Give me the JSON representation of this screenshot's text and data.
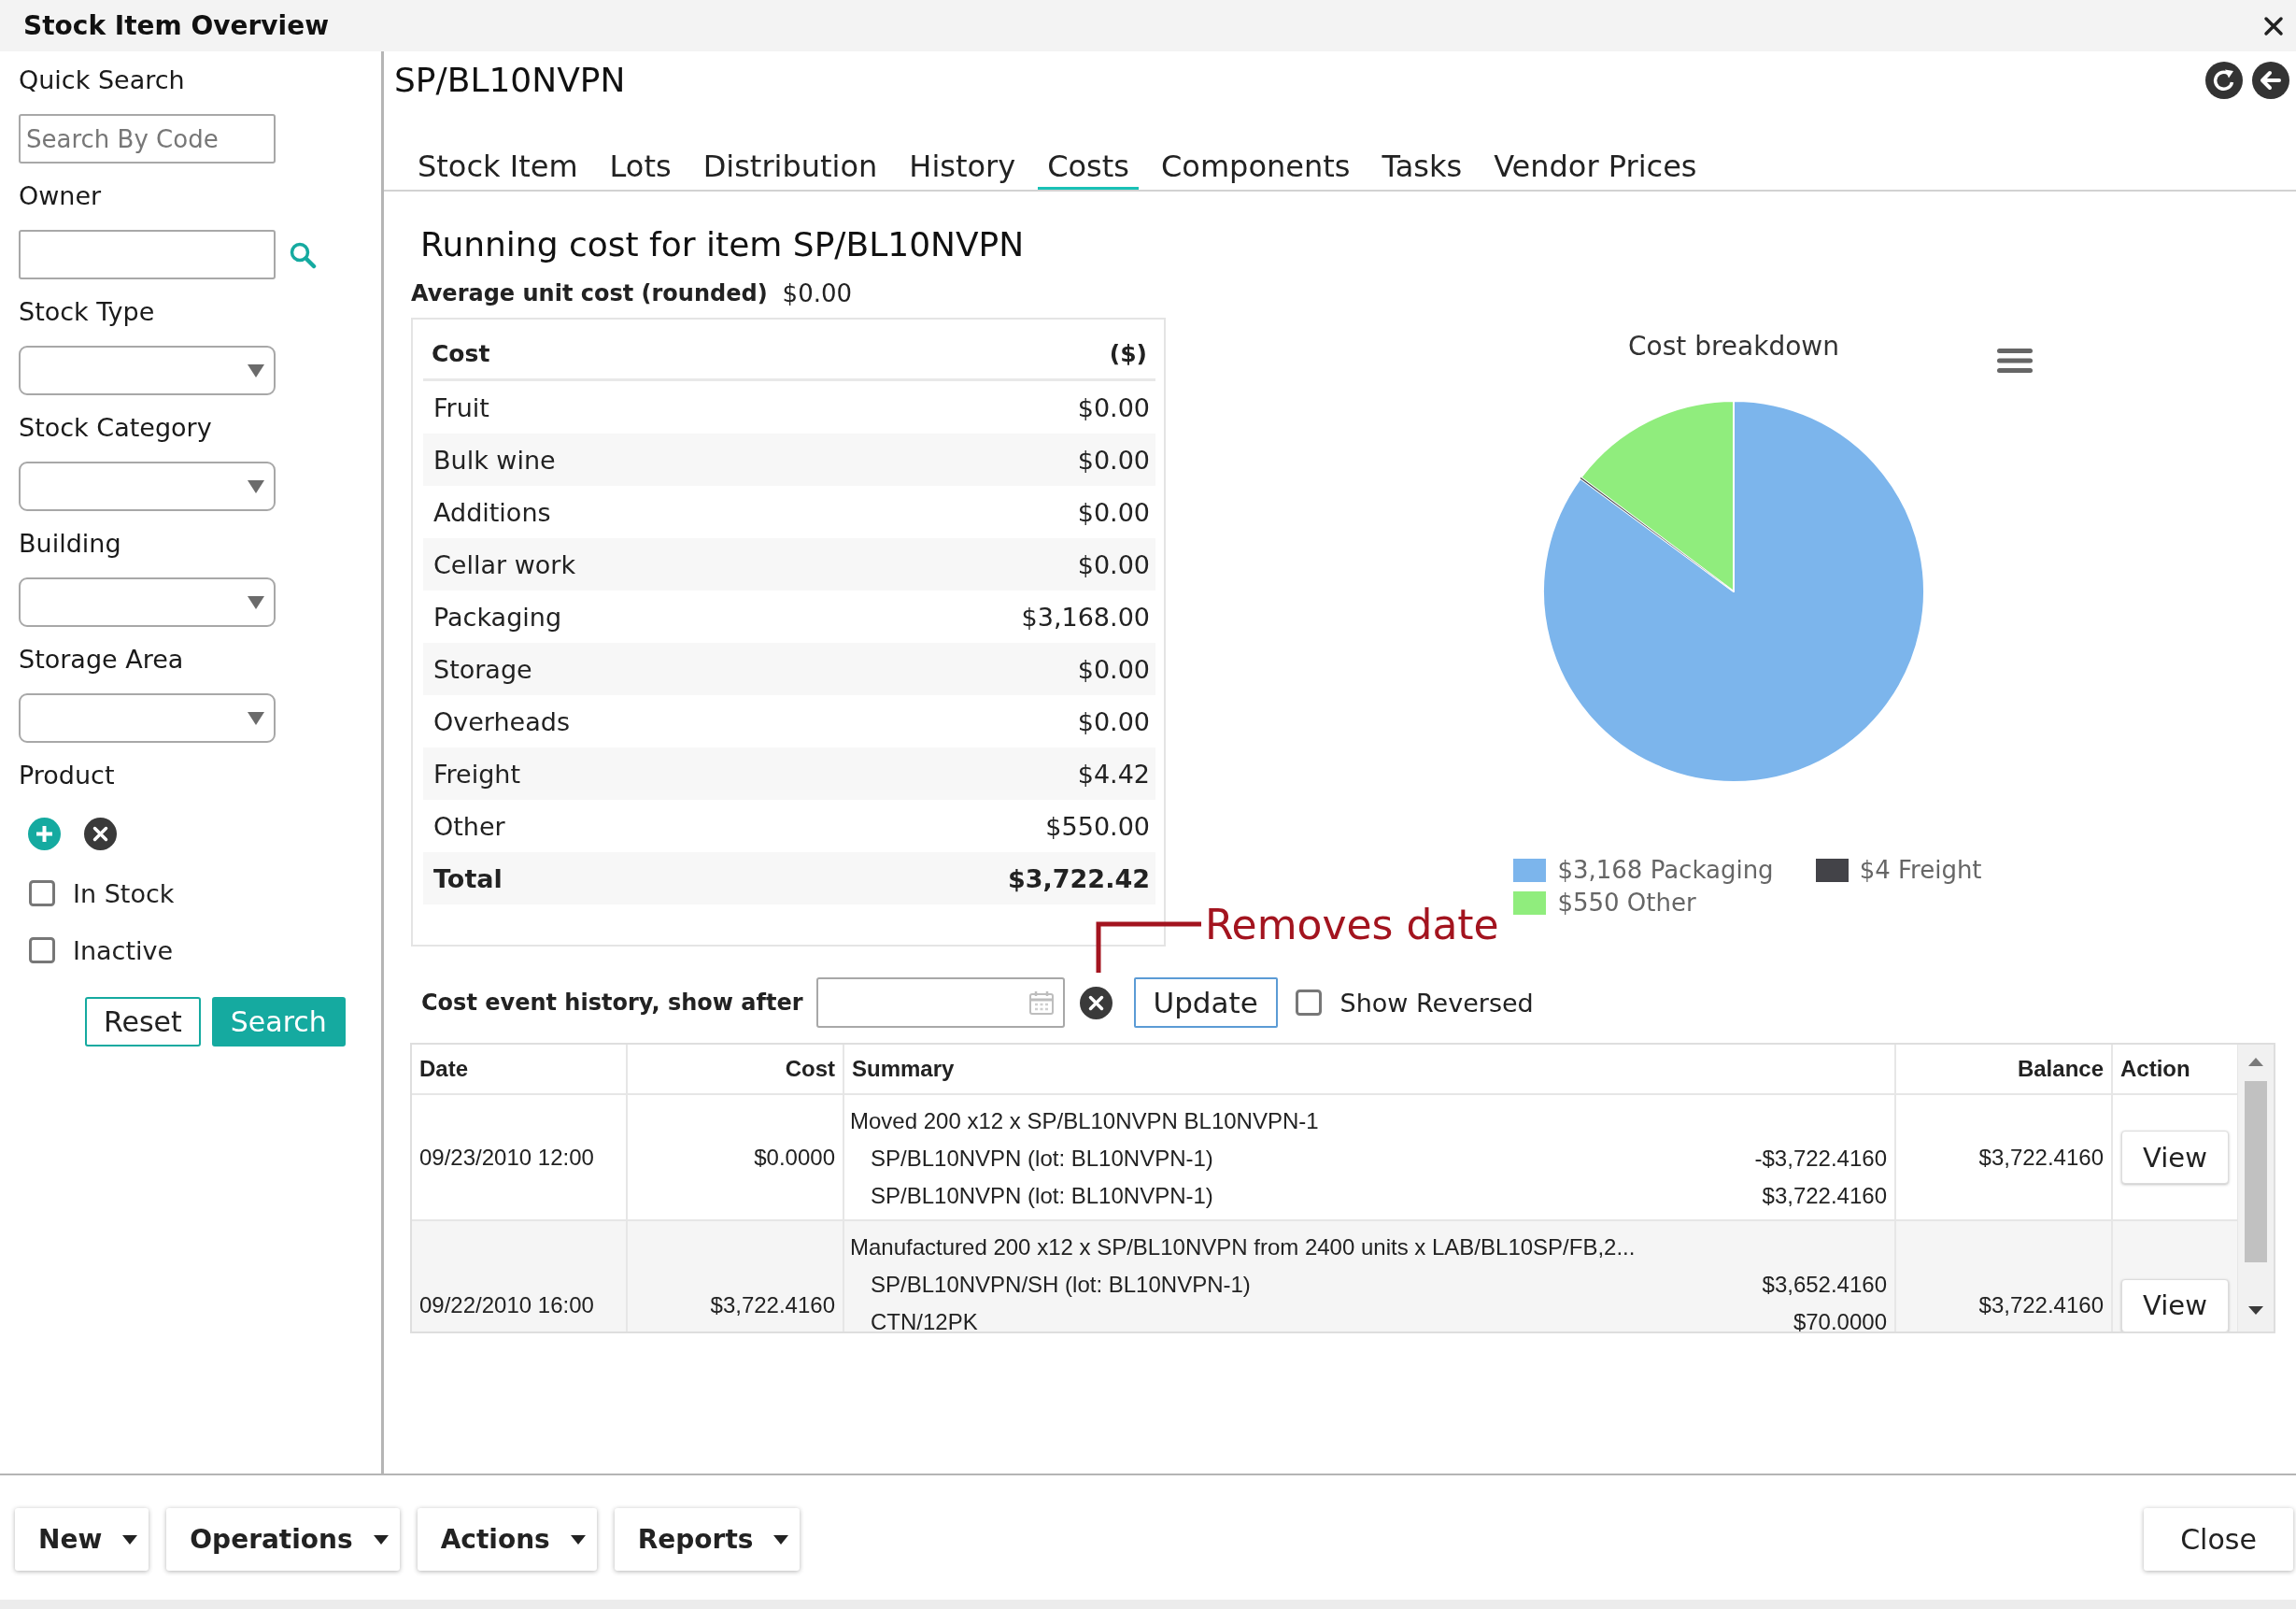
{
  "window": {
    "title": "Stock Item Overview"
  },
  "sidebar": {
    "fields": [
      {
        "kind": "text",
        "label": "Quick Search",
        "placeholder": "Search By Code"
      },
      {
        "kind": "lookup",
        "label": "Owner"
      },
      {
        "kind": "select",
        "label": "Stock Type"
      },
      {
        "kind": "select",
        "label": "Stock Category"
      },
      {
        "kind": "select",
        "label": "Building"
      },
      {
        "kind": "select",
        "label": "Storage Area"
      },
      {
        "kind": "product",
        "label": "Product"
      }
    ],
    "checkboxes": [
      {
        "label": "In Stock",
        "checked": false
      },
      {
        "label": "Inactive",
        "checked": false
      }
    ],
    "buttons": [
      {
        "label": "Reset",
        "primary": false
      },
      {
        "label": "Search",
        "primary": true
      }
    ]
  },
  "item": {
    "code": "SP/BL10NVPN"
  },
  "tabs": [
    {
      "label": "Stock Item",
      "selected": false
    },
    {
      "label": "Lots",
      "selected": false
    },
    {
      "label": "Distribution",
      "selected": false
    },
    {
      "label": "History",
      "selected": false
    },
    {
      "label": "Costs",
      "selected": true
    },
    {
      "label": "Components",
      "selected": false
    },
    {
      "label": "Tasks",
      "selected": false
    },
    {
      "label": "Vendor Prices",
      "selected": false
    }
  ],
  "costs": {
    "title": "Running cost for item SP/BL10NVPN",
    "average": {
      "label": "Average unit cost (rounded)",
      "value": "$0.00"
    },
    "columns": [
      "Cost",
      "($)"
    ],
    "rows": [
      {
        "kind": "item",
        "name": "Fruit",
        "value": "$0.00"
      },
      {
        "kind": "item",
        "name": "Bulk wine",
        "value": "$0.00"
      },
      {
        "kind": "item",
        "name": "Additions",
        "value": "$0.00"
      },
      {
        "kind": "item",
        "name": "Cellar work",
        "value": "$0.00"
      },
      {
        "kind": "item",
        "name": "Packaging",
        "value": "$3,168.00"
      },
      {
        "kind": "item",
        "name": "Storage",
        "value": "$0.00"
      },
      {
        "kind": "item",
        "name": "Overheads",
        "value": "$0.00"
      },
      {
        "kind": "item",
        "name": "Freight",
        "value": "$4.42"
      },
      {
        "kind": "item",
        "name": "Other",
        "value": "$550.00"
      },
      {
        "kind": "total",
        "name": "Total",
        "value": "$3,722.42"
      }
    ]
  },
  "chart": {
    "chart_data": {
      "type": "pie",
      "title": "Cost breakdown",
      "values": [
        85.1,
        0.1,
        14.8
      ]
    },
    "legend": [
      {
        "label": "$3,168 Packaging",
        "color": "#7cb5ec"
      },
      {
        "label": "$4 Freight",
        "color": "#434348"
      },
      {
        "label": "$550 Other",
        "color": "#90ed7d"
      }
    ]
  },
  "annotation": {
    "text": "Removes date"
  },
  "history": {
    "filter_label": "Cost event history, show after",
    "update": "Update",
    "show_reversed": {
      "label": "Show Reversed",
      "checked": false
    },
    "columns": [
      "Date",
      "Cost",
      "Summary",
      "Balance",
      "Action"
    ],
    "rows": [
      {
        "date": "09/23/2010 12:00",
        "cost": "$0.0000",
        "summary": "Moved 200 x12 x SP/BL10NVPN BL10NVPN-1",
        "lines": [
          {
            "text": "SP/BL10NVPN (lot: BL10NVPN-1)",
            "amount": "-$3,722.4160"
          },
          {
            "text": "SP/BL10NVPN (lot: BL10NVPN-1)",
            "amount": "$3,722.4160"
          }
        ],
        "balance": "$3,722.4160",
        "action": "View"
      },
      {
        "date": "09/22/2010 16:00",
        "cost": "$3,722.4160",
        "summary": "Manufactured 200 x12 x SP/BL10NVPN from 2400 units x LAB/BL10SP/FB,2...",
        "lines": [
          {
            "text": "SP/BL10NVPN/SH (lot: BL10NVPN-1)",
            "amount": "$3,652.4160"
          },
          {
            "text": "CTN/12PK",
            "amount": "$70.0000"
          }
        ],
        "balance": "$3,722.4160",
        "action": "View"
      }
    ]
  },
  "toolbar": {
    "menus": [
      "New",
      "Operations",
      "Actions",
      "Reports"
    ],
    "close": "Close"
  }
}
